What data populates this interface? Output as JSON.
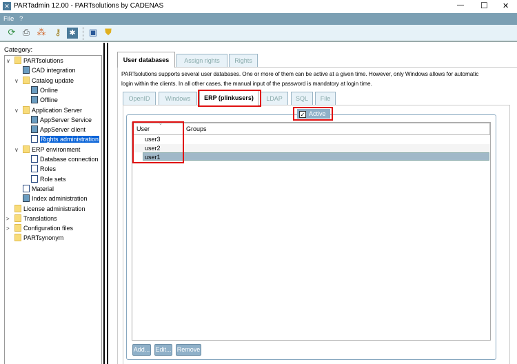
{
  "window": {
    "title": "PARTadmin 12.00 - PARTsolutions by CADENAS",
    "minimize": "—",
    "maximize": "☐",
    "close": "✕"
  },
  "menu": [
    "File",
    "?"
  ],
  "toolbar": [
    "refresh-icon",
    "printer-icon",
    "network-icon",
    "keys-icon",
    "settings-icon",
    "save-icon",
    "shield-icon"
  ],
  "sidebar": {
    "label": "Category:",
    "items": [
      {
        "label": "PARTsolutions",
        "level": 0,
        "icon": "folder",
        "exp": "∨"
      },
      {
        "label": "CAD integration",
        "level": 1,
        "icon": "tool"
      },
      {
        "label": "Catalog update",
        "level": 1,
        "icon": "folder",
        "exp": "∨"
      },
      {
        "label": "Online",
        "level": 2,
        "icon": "tool"
      },
      {
        "label": "Offline",
        "level": 2,
        "icon": "tool"
      },
      {
        "label": "Application Server",
        "level": 1,
        "icon": "folder",
        "exp": "∨"
      },
      {
        "label": "AppServer Service",
        "level": 2,
        "icon": "tool"
      },
      {
        "label": "AppServer client",
        "level": 2,
        "icon": "tool"
      },
      {
        "label": "Rights administration",
        "level": 2,
        "icon": "doc",
        "selected": true
      },
      {
        "label": "ERP environment",
        "level": 1,
        "icon": "folder",
        "exp": "∨"
      },
      {
        "label": "Database connection",
        "level": 2,
        "icon": "doc"
      },
      {
        "label": "Roles",
        "level": 2,
        "icon": "doc"
      },
      {
        "label": "Role sets",
        "level": 2,
        "icon": "doc"
      },
      {
        "label": "Material",
        "level": 1,
        "icon": "doc"
      },
      {
        "label": "Index administration",
        "level": 1,
        "icon": "tool"
      },
      {
        "label": "License administration",
        "level": 0,
        "icon": "folder"
      },
      {
        "label": "Translations",
        "level": 0,
        "icon": "folder",
        "exp": ">"
      },
      {
        "label": "Configuration files",
        "level": 0,
        "icon": "folder",
        "exp": ">"
      },
      {
        "label": "PARTsynonym",
        "level": 0,
        "icon": "folder"
      }
    ]
  },
  "main": {
    "tabs": [
      "User databases",
      "Assign rights",
      "Rights"
    ],
    "description": [
      "PARTsolutions supports several user databases. One or more of them can be active at a given time. However, only Windows allows for automatic",
      "login within the clients. In all other cases, the manual input of the password is mandatory at login time."
    ],
    "subtabs": [
      "OpenID",
      "Windows",
      "ERP (plinkusers)",
      "LDAP",
      "SQL",
      "File"
    ],
    "active_label": "Active",
    "active_checked": true,
    "columns": [
      "User",
      "Groups"
    ],
    "rows": [
      {
        "user": "user3",
        "groups": ""
      },
      {
        "user": "user2",
        "groups": ""
      },
      {
        "user": "user1",
        "groups": "",
        "selected": true
      }
    ],
    "buttons": [
      "Add...",
      "Edit...",
      "Remove"
    ],
    "colors": {
      "highlight": "#e01010",
      "selection": "#a0b8c8"
    }
  }
}
